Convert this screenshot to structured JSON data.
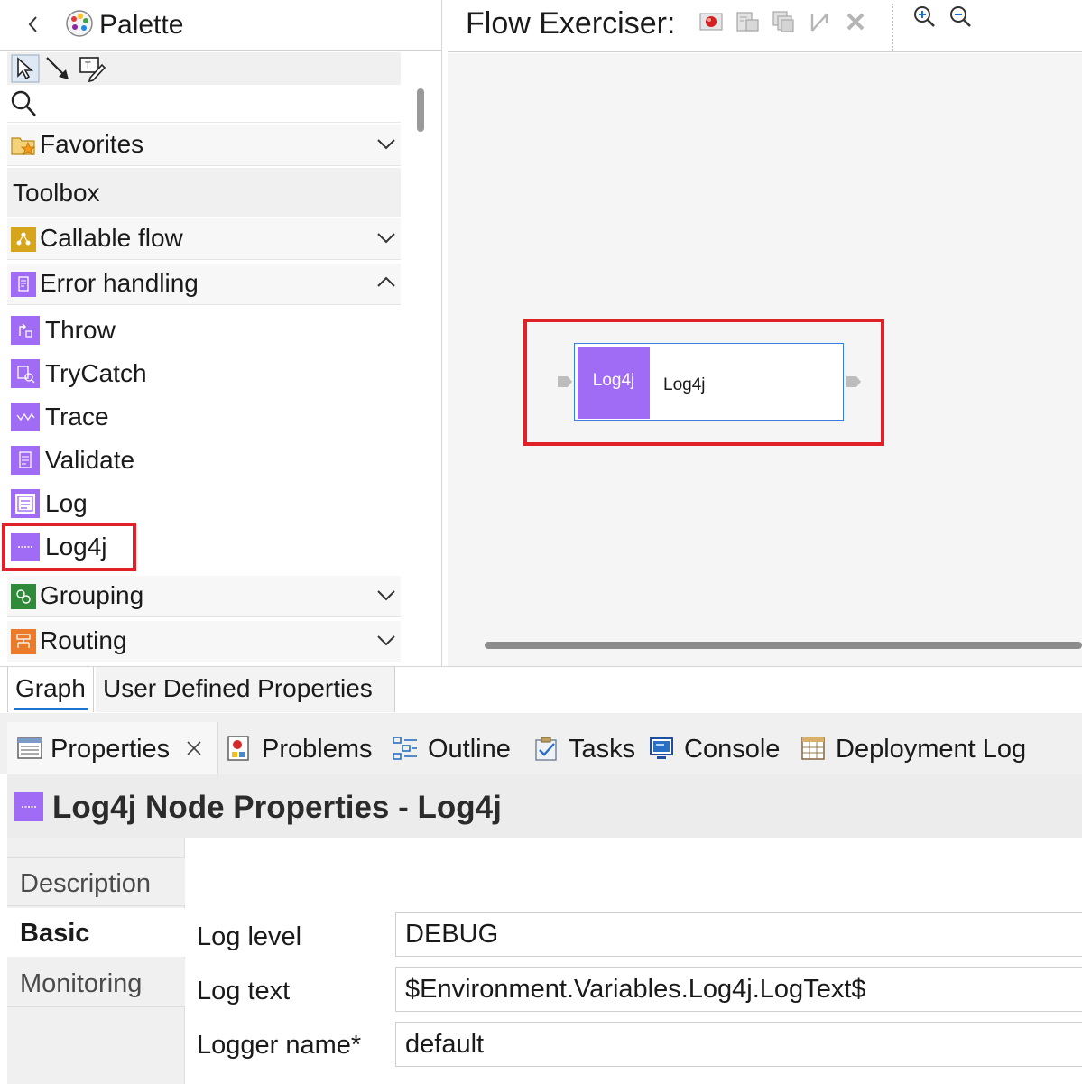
{
  "palette": {
    "title": "Palette",
    "search_placeholder": "",
    "drawers": {
      "favorites": "Favorites",
      "toolbox": "Toolbox",
      "callable_flow": "Callable flow",
      "error_handling": "Error handling",
      "grouping": "Grouping",
      "routing": "Routing"
    },
    "error_handling_items": [
      "Throw",
      "TryCatch",
      "Trace",
      "Validate",
      "Log",
      "Log4j"
    ]
  },
  "canvas": {
    "flow_exerciser_label": "Flow Exerciser:",
    "node": {
      "icon_label": "Log4j",
      "name": "Log4j"
    }
  },
  "editor_tabs": {
    "graph": "Graph",
    "user_defined_properties": "User Defined Properties"
  },
  "views": {
    "properties": "Properties",
    "problems": "Problems",
    "outline": "Outline",
    "tasks": "Tasks",
    "console": "Console",
    "deployment_log": "Deployment Log"
  },
  "properties": {
    "title": "Log4j Node Properties - Log4j",
    "side_tabs": {
      "description": "Description",
      "basic": "Basic",
      "monitoring": "Monitoring"
    },
    "fields": {
      "log_level_label": "Log level",
      "log_level_value": "DEBUG",
      "log_text_label": "Log text",
      "log_text_value": "$Environment.Variables.Log4j.LogText$",
      "logger_name_label": "Logger name*",
      "logger_name_value": "default"
    }
  },
  "colors": {
    "node_purple": "#a06bf5",
    "highlight_red": "#e0212a",
    "selection_blue": "#3d7de0",
    "tab_underline": "#1f6fd1"
  }
}
